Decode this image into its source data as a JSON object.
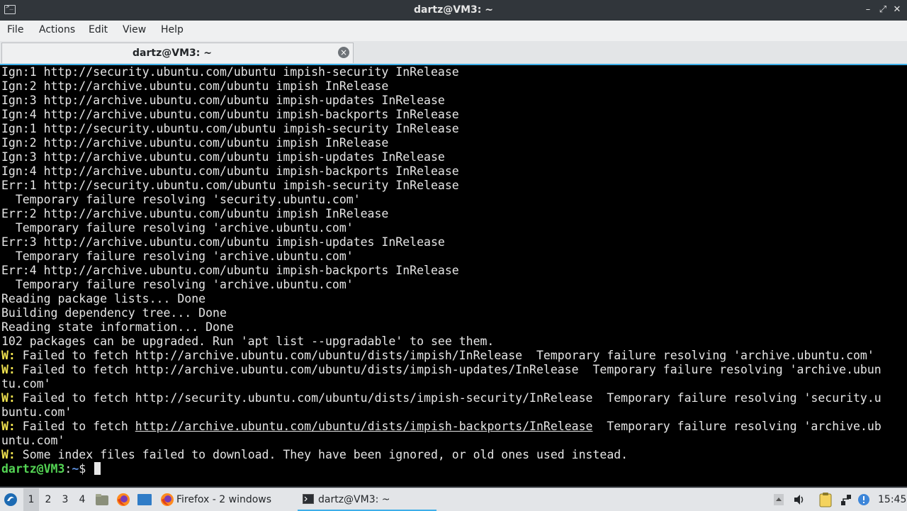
{
  "window": {
    "title": "dartz@VM3: ~",
    "controls": {
      "minimize": "–",
      "restore": "⤢",
      "close": "✕"
    }
  },
  "menu": [
    "File",
    "Actions",
    "Edit",
    "View",
    "Help"
  ],
  "tab": {
    "label": "dartz@VM3: ~",
    "close_icon": "×"
  },
  "terminal": {
    "lines": [
      "Ign:1 http://security.ubuntu.com/ubuntu impish-security InRelease",
      "Ign:2 http://archive.ubuntu.com/ubuntu impish InRelease",
      "Ign:3 http://archive.ubuntu.com/ubuntu impish-updates InRelease",
      "Ign:4 http://archive.ubuntu.com/ubuntu impish-backports InRelease",
      "Ign:1 http://security.ubuntu.com/ubuntu impish-security InRelease",
      "Ign:2 http://archive.ubuntu.com/ubuntu impish InRelease",
      "Ign:3 http://archive.ubuntu.com/ubuntu impish-updates InRelease",
      "Ign:4 http://archive.ubuntu.com/ubuntu impish-backports InRelease",
      "Err:1 http://security.ubuntu.com/ubuntu impish-security InRelease",
      "  Temporary failure resolving 'security.ubuntu.com'",
      "Err:2 http://archive.ubuntu.com/ubuntu impish InRelease",
      "  Temporary failure resolving 'archive.ubuntu.com'",
      "Err:3 http://archive.ubuntu.com/ubuntu impish-updates InRelease",
      "  Temporary failure resolving 'archive.ubuntu.com'",
      "Err:4 http://archive.ubuntu.com/ubuntu impish-backports InRelease",
      "  Temporary failure resolving 'archive.ubuntu.com'",
      "Reading package lists... Done",
      "Building dependency tree... Done",
      "Reading state information... Done",
      "102 packages can be upgraded. Run 'apt list --upgradable' to see them."
    ],
    "warn_prefix": "W:",
    "warnings": [
      {
        "text": " Failed to fetch http://archive.ubuntu.com/ubuntu/dists/impish/InRelease  Temporary failure resolving 'archive.ubuntu.com'"
      },
      {
        "text": " Failed to fetch http://archive.ubuntu.com/ubuntu/dists/impish-updates/InRelease  Temporary failure resolving 'archive.ubun",
        "cont": "tu.com'"
      },
      {
        "text": " Failed to fetch http://security.ubuntu.com/ubuntu/dists/impish-security/InRelease  Temporary failure resolving 'security.u",
        "cont": "buntu.com'"
      },
      {
        "pre": " Failed to fetch ",
        "url": "http://archive.ubuntu.com/ubuntu/dists/impish-backports/InRelease",
        "post": "  Temporary failure resolving 'archive.ub",
        "cont": "untu.com'"
      },
      {
        "text": " Some index files failed to download. They have been ignored, or old ones used instead."
      }
    ],
    "prompt": {
      "user": "dartz@VM3",
      "sep": ":",
      "path": "~",
      "symbol": "$ "
    }
  },
  "taskbar": {
    "desktops": [
      "1",
      "2",
      "3",
      "4"
    ],
    "active_desktop": "1",
    "tasks": [
      {
        "icon": "firefox-icon",
        "label": "Firefox - 2 windows"
      },
      {
        "icon": "terminal-icon",
        "label": "dartz@VM3: ~"
      }
    ],
    "clock": "15:45"
  },
  "colors": {
    "accent": "#3daee9",
    "terminal_bg": "#000000",
    "terminal_fg": "#e6e6e6",
    "warn": "#f0e24f",
    "prompt_user": "#54d454",
    "prompt_path": "#5c8fdc"
  }
}
